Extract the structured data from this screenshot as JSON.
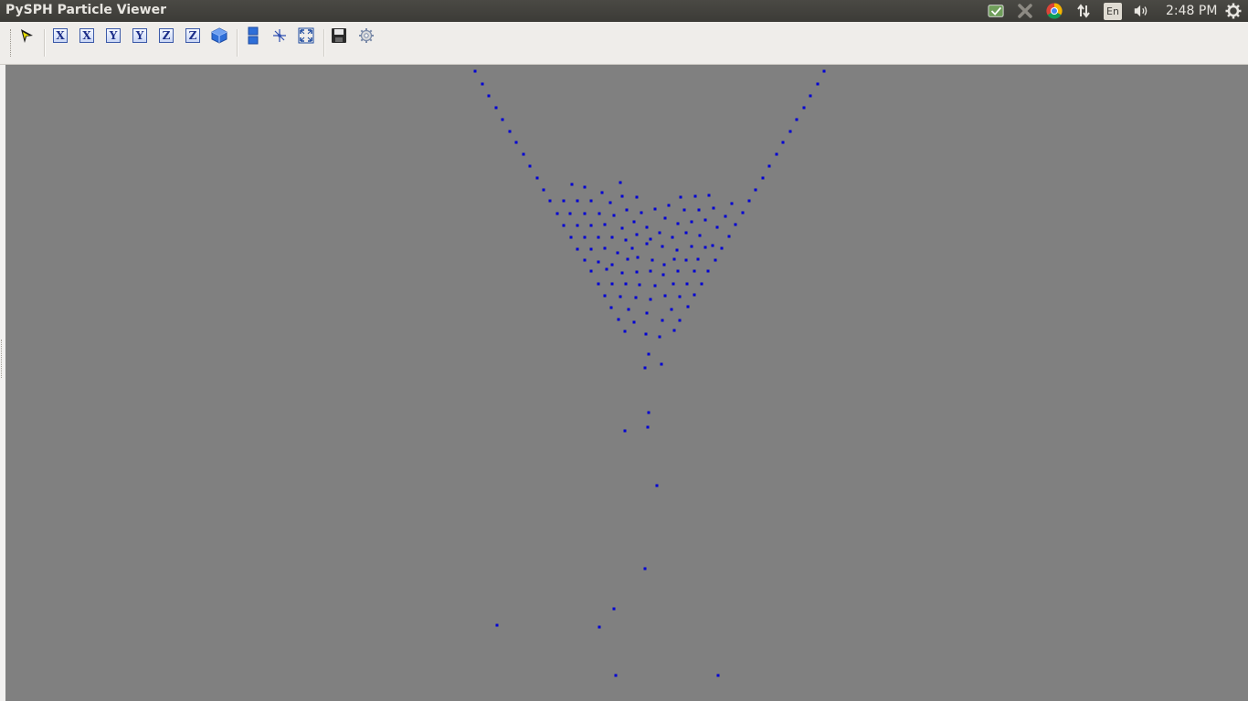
{
  "window": {
    "title": "PySPH Particle Viewer"
  },
  "system_tray": {
    "language": "En",
    "clock": "2:48 PM",
    "icons": [
      "keyboard-indicator-icon",
      "mute-app-icon",
      "chrome-icon",
      "network-updown-icon",
      "language-icon",
      "volume-icon",
      "power-gear-icon"
    ]
  },
  "toolbar": {
    "items": [
      {
        "name": "interaction-mode-icon",
        "glyph": "pointer"
      },
      {
        "name": "view-x-plus-icon",
        "label": "X"
      },
      {
        "name": "view-x-minus-icon",
        "label": "X"
      },
      {
        "name": "view-y-plus-icon",
        "label": "Y"
      },
      {
        "name": "view-y-minus-icon",
        "label": "Y"
      },
      {
        "name": "view-z-plus-icon",
        "label": "Z"
      },
      {
        "name": "view-z-minus-icon",
        "label": "Z"
      },
      {
        "name": "isometric-view-icon",
        "glyph": "cube"
      },
      {
        "name": "toggle-scene-panel-icon",
        "glyph": "panel"
      },
      {
        "name": "toggle-axes-icon",
        "glyph": "axes"
      },
      {
        "name": "full-screen-icon",
        "glyph": "expand"
      },
      {
        "name": "save-scene-icon",
        "glyph": "floppy"
      },
      {
        "name": "configure-icon",
        "glyph": "gear"
      }
    ]
  },
  "viewer": {
    "background_color": "#808080",
    "particle_color": "#0000d4"
  }
}
